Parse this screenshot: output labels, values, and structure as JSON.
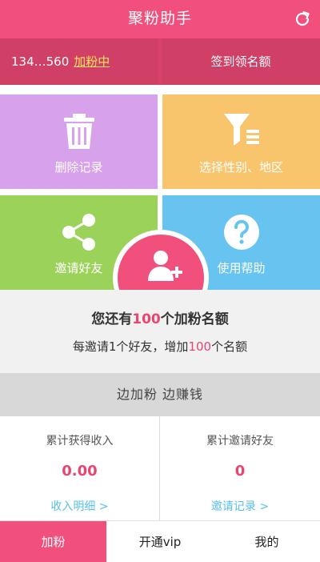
{
  "header": {
    "title": "聚粉助手"
  },
  "account": {
    "phone": "134…560",
    "status": "加粉中",
    "checkin_label": "签到领名额"
  },
  "tiles": {
    "delete": "删除记录",
    "select": "选择性别、地区",
    "invite": "邀请好友",
    "help": "使用帮助",
    "add_fans": "加粉"
  },
  "quota": {
    "line1_prefix": "您还有",
    "line1_num": "100",
    "line1_suffix": "个加粉名额",
    "line2_prefix": "每邀请1个好友，增加",
    "line2_num": "100",
    "line2_suffix": "个名额"
  },
  "slogan": "边加粉 边赚钱",
  "stats": {
    "income_label": "累计获得收入",
    "income_value": "0.00",
    "income_link": "收入明细 >",
    "invite_label": "累计邀请好友",
    "invite_value": "0",
    "invite_link": "邀请记录 >"
  },
  "bottom_tabs": [
    "加粉",
    "开通vip",
    "我的"
  ],
  "colors": {
    "primary": "#f0507b",
    "delete_tile": "#d7a1ec",
    "select_tile": "#f8c46c",
    "invite_tile": "#9bd25a",
    "help_tile": "#67c4f0",
    "link": "#5ac0e8"
  }
}
